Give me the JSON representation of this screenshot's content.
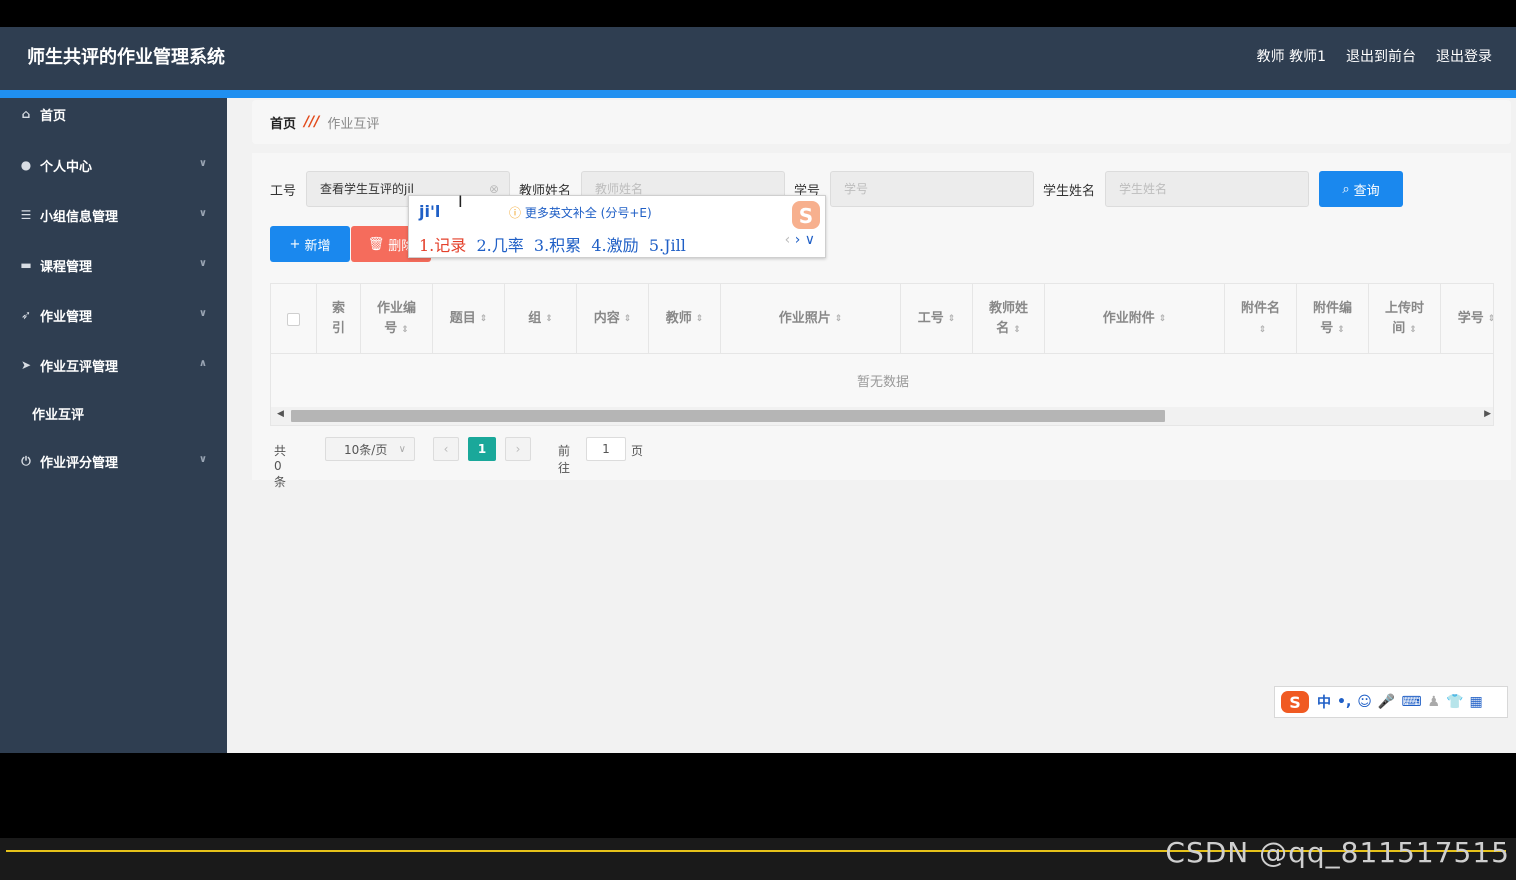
{
  "header": {
    "title": "师生共评的作业管理系统",
    "user": "教师 教师1",
    "back_front": "退出到前台",
    "logout": "退出登录"
  },
  "sidebar": {
    "items": [
      {
        "label": "首页",
        "icon": "home-icon"
      },
      {
        "label": "个人中心",
        "icon": "user-icon"
      },
      {
        "label": "小组信息管理",
        "icon": "sliders-icon"
      },
      {
        "label": "课程管理",
        "icon": "message-icon"
      },
      {
        "label": "作业管理",
        "icon": "send-icon"
      },
      {
        "label": "作业互评管理",
        "icon": "paper-plane-icon"
      },
      {
        "label": "作业互评",
        "icon": ""
      },
      {
        "label": "作业评分管理",
        "icon": "power-icon"
      }
    ]
  },
  "breadcrumb": {
    "home": "首页",
    "separator": "///",
    "current": "作业互评"
  },
  "search": {
    "gonghao_label": "工号",
    "gonghao_value": "查看学生互评的jil",
    "teacher_label": "教师姓名",
    "teacher_placeholder": "教师姓名",
    "xuehao_label": "学号",
    "xuehao_placeholder": "学号",
    "student_label": "学生姓名",
    "student_placeholder": "学生姓名",
    "query_button": "查询"
  },
  "actions": {
    "add": "新增",
    "delete": "删除"
  },
  "table": {
    "headers": [
      "索引",
      "作业编号",
      "题目",
      "组",
      "内容",
      "教师",
      "作业照片",
      "工号",
      "教师姓名",
      "作业附件",
      "附件名",
      "附件编号",
      "上传时间",
      "学号"
    ],
    "empty_text": "暂无数据"
  },
  "pagination": {
    "total": "共 0 条",
    "page_size": "10条/页",
    "current_page": "1",
    "goto_label": "前往",
    "goto_value": "1",
    "page_suffix": "页"
  },
  "ime": {
    "composition": "ji'l",
    "hint": "更多英文补全 (分号+E)",
    "candidates": [
      "1.记录",
      "2.几率",
      "3.积累",
      "4.激励",
      "5.Jill"
    ],
    "toolbar_lang": "中"
  },
  "watermark": "CSDN @qq_811517515",
  "colors": {
    "header_bg": "#2f3e51",
    "accent_blue": "#1a88ee",
    "delete_red": "#f56c5c",
    "page_active": "#1aa89a"
  }
}
